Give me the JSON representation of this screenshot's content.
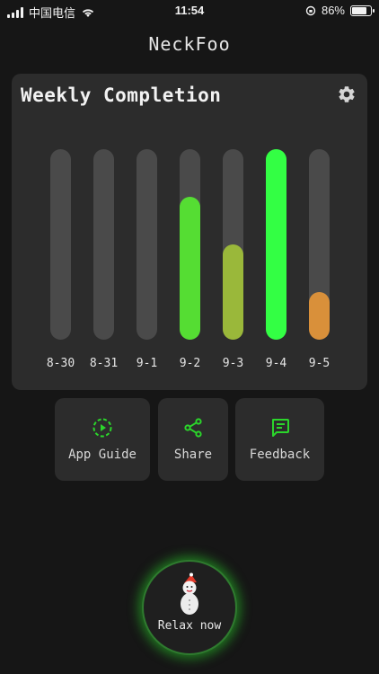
{
  "status_bar": {
    "carrier": "中国电信",
    "time": "11:54",
    "battery": "86%"
  },
  "app": {
    "title": "NeckFoo"
  },
  "weekly": {
    "title": "Weekly Completion"
  },
  "chart_data": {
    "type": "bar",
    "categories": [
      "8-30",
      "8-31",
      "9-1",
      "9-2",
      "9-3",
      "9-4",
      "9-5"
    ],
    "values": [
      0,
      0,
      0,
      75,
      50,
      100,
      25
    ],
    "ylim": [
      0,
      100
    ],
    "bar_colors": [
      "#4a4a4a",
      "#4a4a4a",
      "#4a4a4a",
      "#55dd33",
      "#9ab83a",
      "#33ff44",
      "#d9903a"
    ],
    "track_color": "#4a4a4a"
  },
  "actions": [
    {
      "label": "App Guide",
      "icon": "play-circle-icon"
    },
    {
      "label": "Share",
      "icon": "share-icon"
    },
    {
      "label": "Feedback",
      "icon": "message-icon"
    }
  ],
  "relax": {
    "label": "Relax now"
  },
  "colors": {
    "accent": "#2bd62b",
    "background": "#161616",
    "card": "#2c2c2c"
  }
}
